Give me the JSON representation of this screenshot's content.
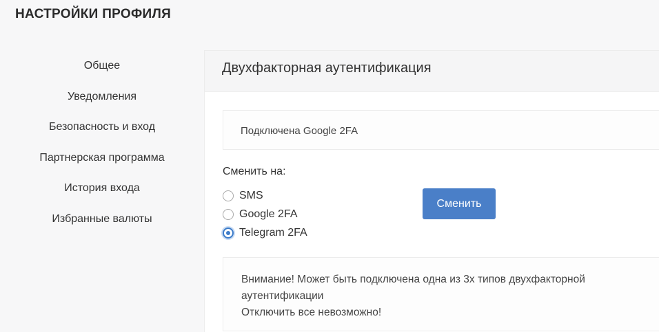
{
  "page": {
    "title": "НАСТРОЙКИ ПРОФИЛЯ"
  },
  "sidebar": {
    "items": [
      {
        "label": "Общее"
      },
      {
        "label": "Уведомления"
      },
      {
        "label": "Безопасность и вход"
      },
      {
        "label": "Партнерская программа"
      },
      {
        "label": "История входа"
      },
      {
        "label": "Избранные валюты"
      }
    ]
  },
  "panel": {
    "title": "Двухфакторная аутентификация",
    "status": "Подключена Google 2FA",
    "switch_label": "Сменить на:",
    "options": [
      {
        "label": "SMS",
        "checked": false
      },
      {
        "label": "Google 2FA",
        "checked": false
      },
      {
        "label": "Telegram 2FA",
        "checked": true
      }
    ],
    "button_label": "Сменить",
    "warning": {
      "line1": "Внимание! Может быть подключена одна из 3х типов двухфакторной",
      "line2": "аутентификации",
      "line3": "Отключить все невозможно!"
    }
  },
  "colors": {
    "accent": "#4a7fc8",
    "background": "#f7f7f8",
    "panel_header": "#f5f5f6"
  }
}
